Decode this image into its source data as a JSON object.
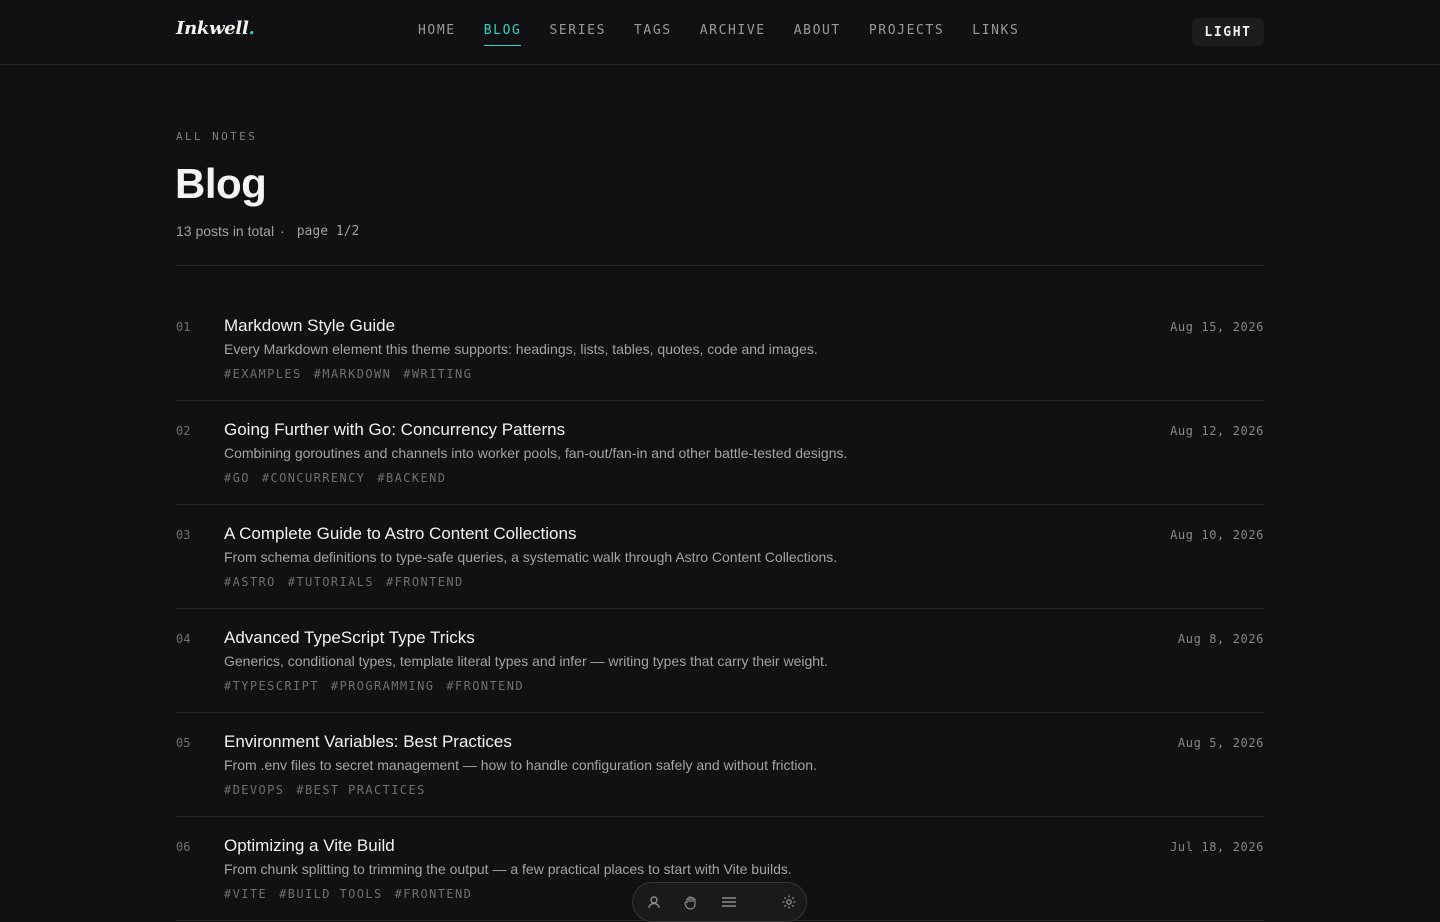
{
  "header": {
    "logo_text": "Inkwell",
    "logo_dot": ".",
    "nav": [
      {
        "label": "HOME",
        "active": false
      },
      {
        "label": "BLOG",
        "active": true
      },
      {
        "label": "SERIES",
        "active": false
      },
      {
        "label": "TAGS",
        "active": false
      },
      {
        "label": "ARCHIVE",
        "active": false
      },
      {
        "label": "ABOUT",
        "active": false
      },
      {
        "label": "PROJECTS",
        "active": false
      },
      {
        "label": "LINKS",
        "active": false
      }
    ],
    "theme_toggle_label": "LIGHT"
  },
  "page": {
    "eyebrow": "ALL NOTES",
    "title": "Blog",
    "total_text": "13 posts in total",
    "separator": "·",
    "page_indicator": "page 1/2"
  },
  "posts": [
    {
      "num": "01",
      "title": "Markdown Style Guide",
      "desc": "Every Markdown element this theme supports: headings, lists, tables, quotes, code and images.",
      "date": "Aug 15, 2026",
      "tags": [
        "#EXAMPLES",
        "#MARKDOWN",
        "#WRITING"
      ]
    },
    {
      "num": "02",
      "title": "Going Further with Go: Concurrency Patterns",
      "desc": "Combining goroutines and channels into worker pools, fan-out/fan-in and other battle-tested designs.",
      "date": "Aug 12, 2026",
      "tags": [
        "#GO",
        "#CONCURRENCY",
        "#BACKEND"
      ]
    },
    {
      "num": "03",
      "title": "A Complete Guide to Astro Content Collections",
      "desc": "From schema definitions to type-safe queries, a systematic walk through Astro Content Collections.",
      "date": "Aug 10, 2026",
      "tags": [
        "#ASTRO",
        "#TUTORIALS",
        "#FRONTEND"
      ]
    },
    {
      "num": "04",
      "title": "Advanced TypeScript Type Tricks",
      "desc": "Generics, conditional types, template literal types and infer — writing types that carry their weight.",
      "date": "Aug 8, 2026",
      "tags": [
        "#TYPESCRIPT",
        "#PROGRAMMING",
        "#FRONTEND"
      ]
    },
    {
      "num": "05",
      "title": "Environment Variables: Best Practices",
      "desc": "From .env files to secret management — how to handle configuration safely and without friction.",
      "date": "Aug 5, 2026",
      "tags": [
        "#DEVOPS",
        "#BEST PRACTICES"
      ]
    },
    {
      "num": "06",
      "title": "Optimizing a Vite Build",
      "desc": "From chunk splitting to trimming the output — a few practical places to start with Vite builds.",
      "date": "Jul 18, 2026",
      "tags": [
        "#VITE",
        "#BUILD TOOLS",
        "#FRONTEND"
      ]
    }
  ],
  "toolbar": {
    "icons": [
      "user-icon",
      "hand-icon",
      "menu-icon",
      "gear-icon"
    ]
  },
  "colors": {
    "accent": "#2dd4bf",
    "background": "#111113"
  }
}
